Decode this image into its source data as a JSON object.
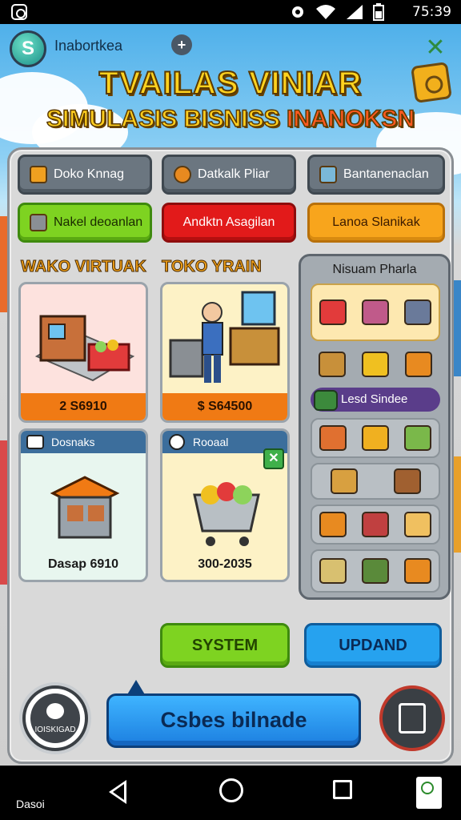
{
  "status": {
    "time": "75:39"
  },
  "header": {
    "player_name": "Inabortkea",
    "badge_letter": "S",
    "plus_label": "+"
  },
  "title": {
    "line1": "TVAILAS VINIAR",
    "line2_a": "SIMULASIS BISNISS",
    "line2_b": "INANOKSN"
  },
  "tabs": {
    "row1": [
      "Doko Knnag",
      "Datkalk Pliar",
      "Bantanenaclan"
    ],
    "row2": [
      "Nakel deoanlan",
      "Andktn Asagilan",
      "Lanoa Slanikak"
    ]
  },
  "sections": {
    "left": "WAKO VIRTUAK",
    "middle": "TOKO YRAIN"
  },
  "cards": [
    {
      "price": "2 S6910"
    },
    {
      "price": "$ S64500"
    },
    {
      "header": "Dosnaks",
      "value": "Dasap 6910"
    },
    {
      "header": "Rooaal",
      "value": "300-2035"
    }
  ],
  "side_panel": {
    "title": "Nisuam Pharla",
    "label": "Lesd Sindee"
  },
  "buttons": {
    "system": "SYSTEM",
    "update": "UPDAND",
    "cta": "Csbes bilnade",
    "round_left": "IOISKIGAD"
  },
  "nav": {
    "label": "Dasoi"
  }
}
